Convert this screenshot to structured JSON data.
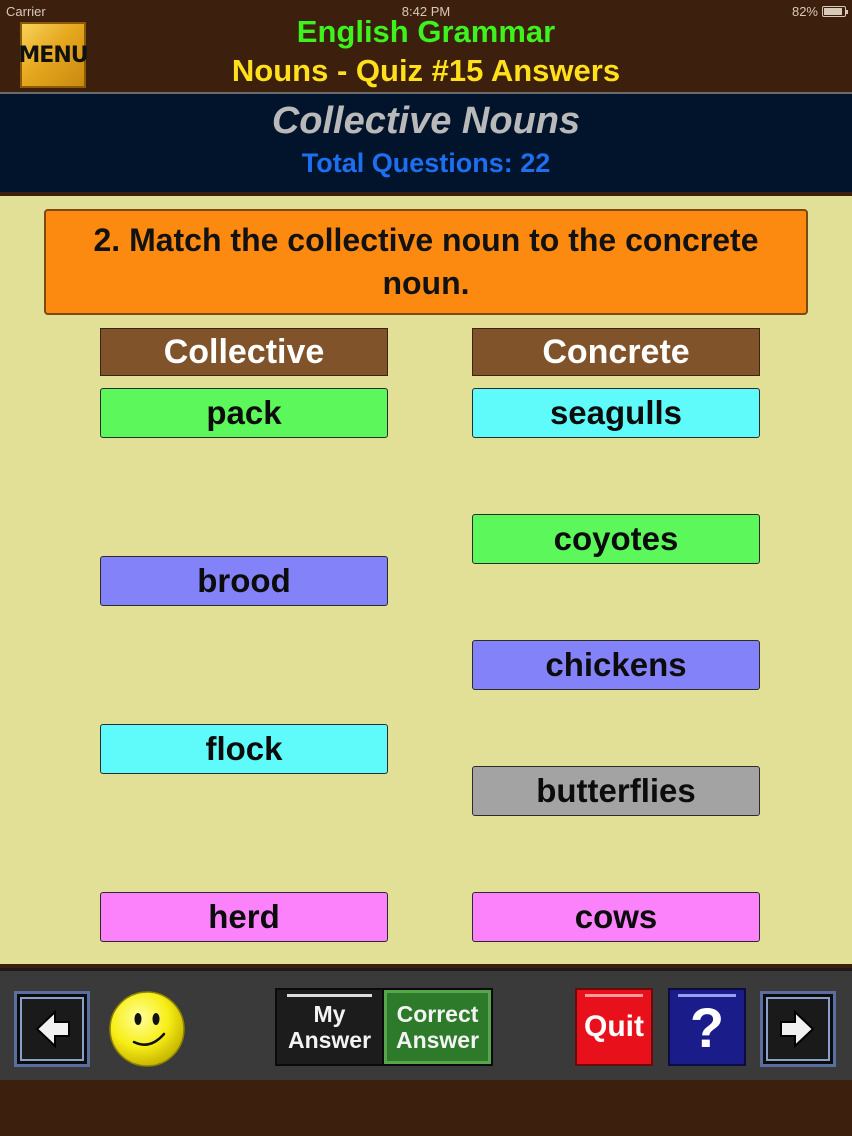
{
  "status_bar": {
    "carrier": "Carrier",
    "time": "8:42 PM",
    "battery": "82%"
  },
  "header": {
    "menu_label": "MENU",
    "app_title": "English Grammar",
    "quiz_title": "Nouns - Quiz #15 Answers"
  },
  "topic": {
    "title": "Collective Nouns",
    "total_questions": "Total Questions: 22"
  },
  "question": {
    "text": "2. Match the collective noun to the concrete noun."
  },
  "columns": {
    "collective_header": "Collective",
    "concrete_header": "Concrete",
    "collective": [
      {
        "label": "pack",
        "color": "#5cf75a"
      },
      {
        "label": "brood",
        "color": "#8482f8"
      },
      {
        "label": "flock",
        "color": "#5ffbfb"
      },
      {
        "label": "herd",
        "color": "#fb82fb"
      }
    ],
    "concrete": [
      {
        "label": "seagulls",
        "color": "#5ffbfb"
      },
      {
        "label": "coyotes",
        "color": "#5cf75a"
      },
      {
        "label": "chickens",
        "color": "#8482f8"
      },
      {
        "label": "butterflies",
        "color": "#a3a3a3"
      },
      {
        "label": "cows",
        "color": "#fb82fb"
      }
    ]
  },
  "toolbar": {
    "prev_icon": "left-arrow-icon",
    "feedback_icon": "smiley-icon",
    "my_answer_label": "My\nAnswer",
    "correct_answer_label": "Correct\nAnswer",
    "quit_label": "Quit",
    "help_label": "?",
    "next_icon": "right-arrow-icon"
  }
}
